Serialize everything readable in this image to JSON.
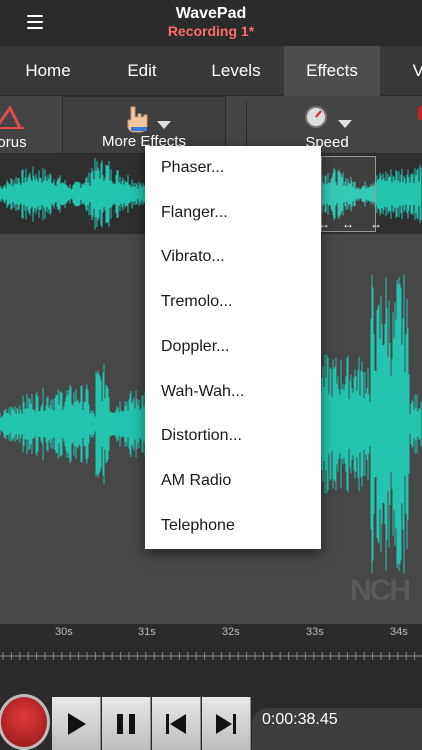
{
  "header": {
    "app_title": "WavePad",
    "file_title": "Recording 1*"
  },
  "tabs": [
    {
      "label": "Home"
    },
    {
      "label": "Edit"
    },
    {
      "label": "Levels"
    },
    {
      "label": "Effects",
      "active": true
    },
    {
      "label": "Vi"
    }
  ],
  "toolbar": {
    "chorus_label": "orus",
    "more_effects_label": "More Effects",
    "speed_label": "Speed"
  },
  "dropdown": {
    "items": [
      "Phaser...",
      "Flanger...",
      "Vibrato...",
      "Tremolo...",
      "Doppler...",
      "Wah-Wah...",
      "Distortion...",
      "AM Radio",
      "Telephone"
    ]
  },
  "timeline": {
    "labels": [
      "30s",
      "31s",
      "32s",
      "33s",
      "34s"
    ]
  },
  "transport": {
    "time": "0:00:38.45"
  },
  "watermark": "NCH",
  "colors": {
    "waveform": "#23c4b0",
    "accent_red": "#ff6a6a",
    "record": "#c62424"
  },
  "icons": {
    "menu": "hamburger-icon",
    "chorus": "chorus-icon",
    "more_effects": "hand-pointer-icon",
    "speed": "speedometer-icon",
    "dropdown": "triangle-down-icon",
    "record": "record-icon",
    "play": "play-icon",
    "pause": "pause-icon",
    "skip_start": "skip-start-icon",
    "skip_end": "skip-end-icon"
  }
}
